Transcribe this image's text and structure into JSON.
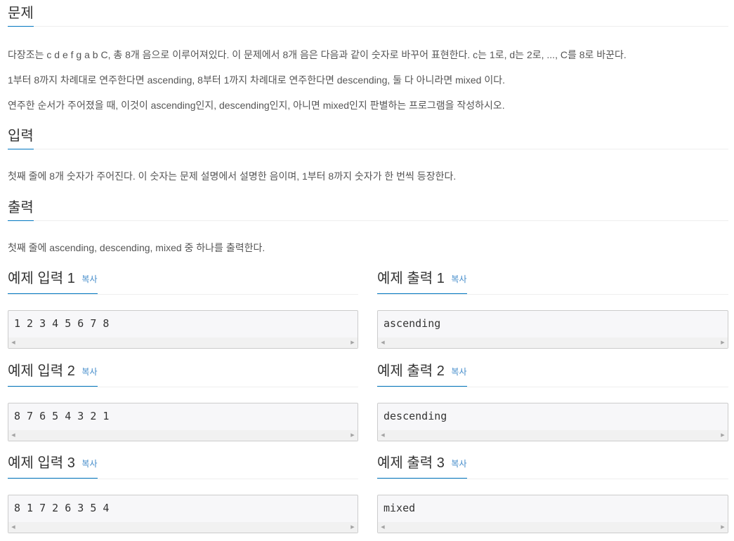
{
  "problem": {
    "title": "문제",
    "paragraphs": [
      "다장조는 c d e f g a b C, 총 8개 음으로 이루어져있다. 이 문제에서 8개 음은 다음과 같이 숫자로 바꾸어 표현한다. c는 1로, d는 2로, ..., C를 8로 바꾼다.",
      "1부터 8까지 차례대로 연주한다면 ascending, 8부터 1까지 차례대로 연주한다면 descending, 둘 다 아니라면 mixed 이다.",
      "연주한 순서가 주어졌을 때, 이것이 ascending인지, descending인지, 아니면 mixed인지 판별하는 프로그램을 작성하시오."
    ]
  },
  "input": {
    "title": "입력",
    "text": "첫째 줄에 8개 숫자가 주어진다. 이 숫자는 문제 설명에서 설명한 음이며, 1부터 8까지 숫자가 한 번씩 등장한다."
  },
  "output": {
    "title": "출력",
    "text": "첫째 줄에 ascending, descending, mixed 중 하나를 출력한다."
  },
  "copy_label": "복사",
  "samples": [
    {
      "input_title": "예제 입력 1",
      "input_value": "1 2 3 4 5 6 7 8",
      "output_title": "예제 출력 1",
      "output_value": "ascending"
    },
    {
      "input_title": "예제 입력 2",
      "input_value": "8 7 6 5 4 3 2 1",
      "output_title": "예제 출력 2",
      "output_value": "descending"
    },
    {
      "input_title": "예제 입력 3",
      "input_value": "8 1 7 2 6 3 5 4",
      "output_title": "예제 출력 3",
      "output_value": "mixed"
    }
  ],
  "colors": {
    "accent": "#0076c0",
    "link": "#428bca",
    "code_bg": "#f7f7f9"
  }
}
